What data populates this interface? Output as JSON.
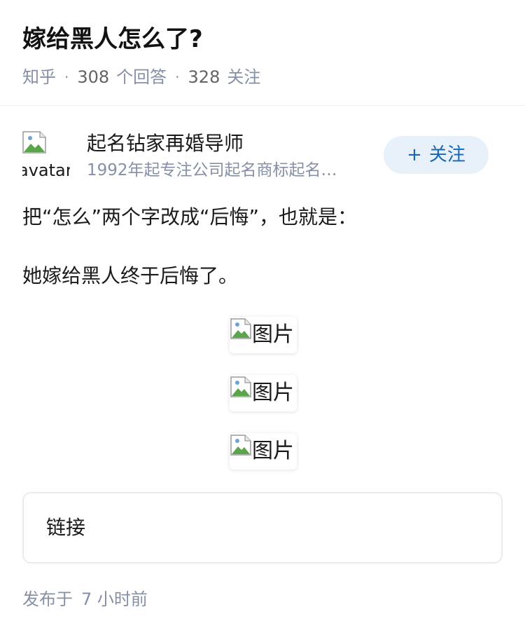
{
  "question": {
    "title": "嫁给黑人怎么了?",
    "source": "知乎",
    "dot": "·",
    "answer_count": "308",
    "answer_label": "个回答",
    "follower_count": "328",
    "follower_label": "关注"
  },
  "author": {
    "avatar_alt": "avatar",
    "name": "起名钻家再婚导师",
    "bio": "1992年起专注公司起名商标起名…",
    "follow_plus": "+",
    "follow_label": "关注"
  },
  "answer": {
    "paragraphs": [
      "把“怎么”两个字改成“后悔”，也就是：",
      "她嫁给黑人终于后悔了。"
    ],
    "images": [
      {
        "alt": "图片",
        "icon": "broken-image-icon"
      },
      {
        "alt": "图片",
        "icon": "broken-image-icon"
      },
      {
        "alt": "图片",
        "icon": "broken-image-icon"
      }
    ],
    "link_card_label": "链接"
  },
  "footer": {
    "published_prefix": "发布于",
    "published_time": "7 小时前"
  },
  "colors": {
    "meta_gray": "#8590a6",
    "follow_bg": "#e8f0f9",
    "follow_text": "#1766b8",
    "border": "#ebebeb"
  }
}
